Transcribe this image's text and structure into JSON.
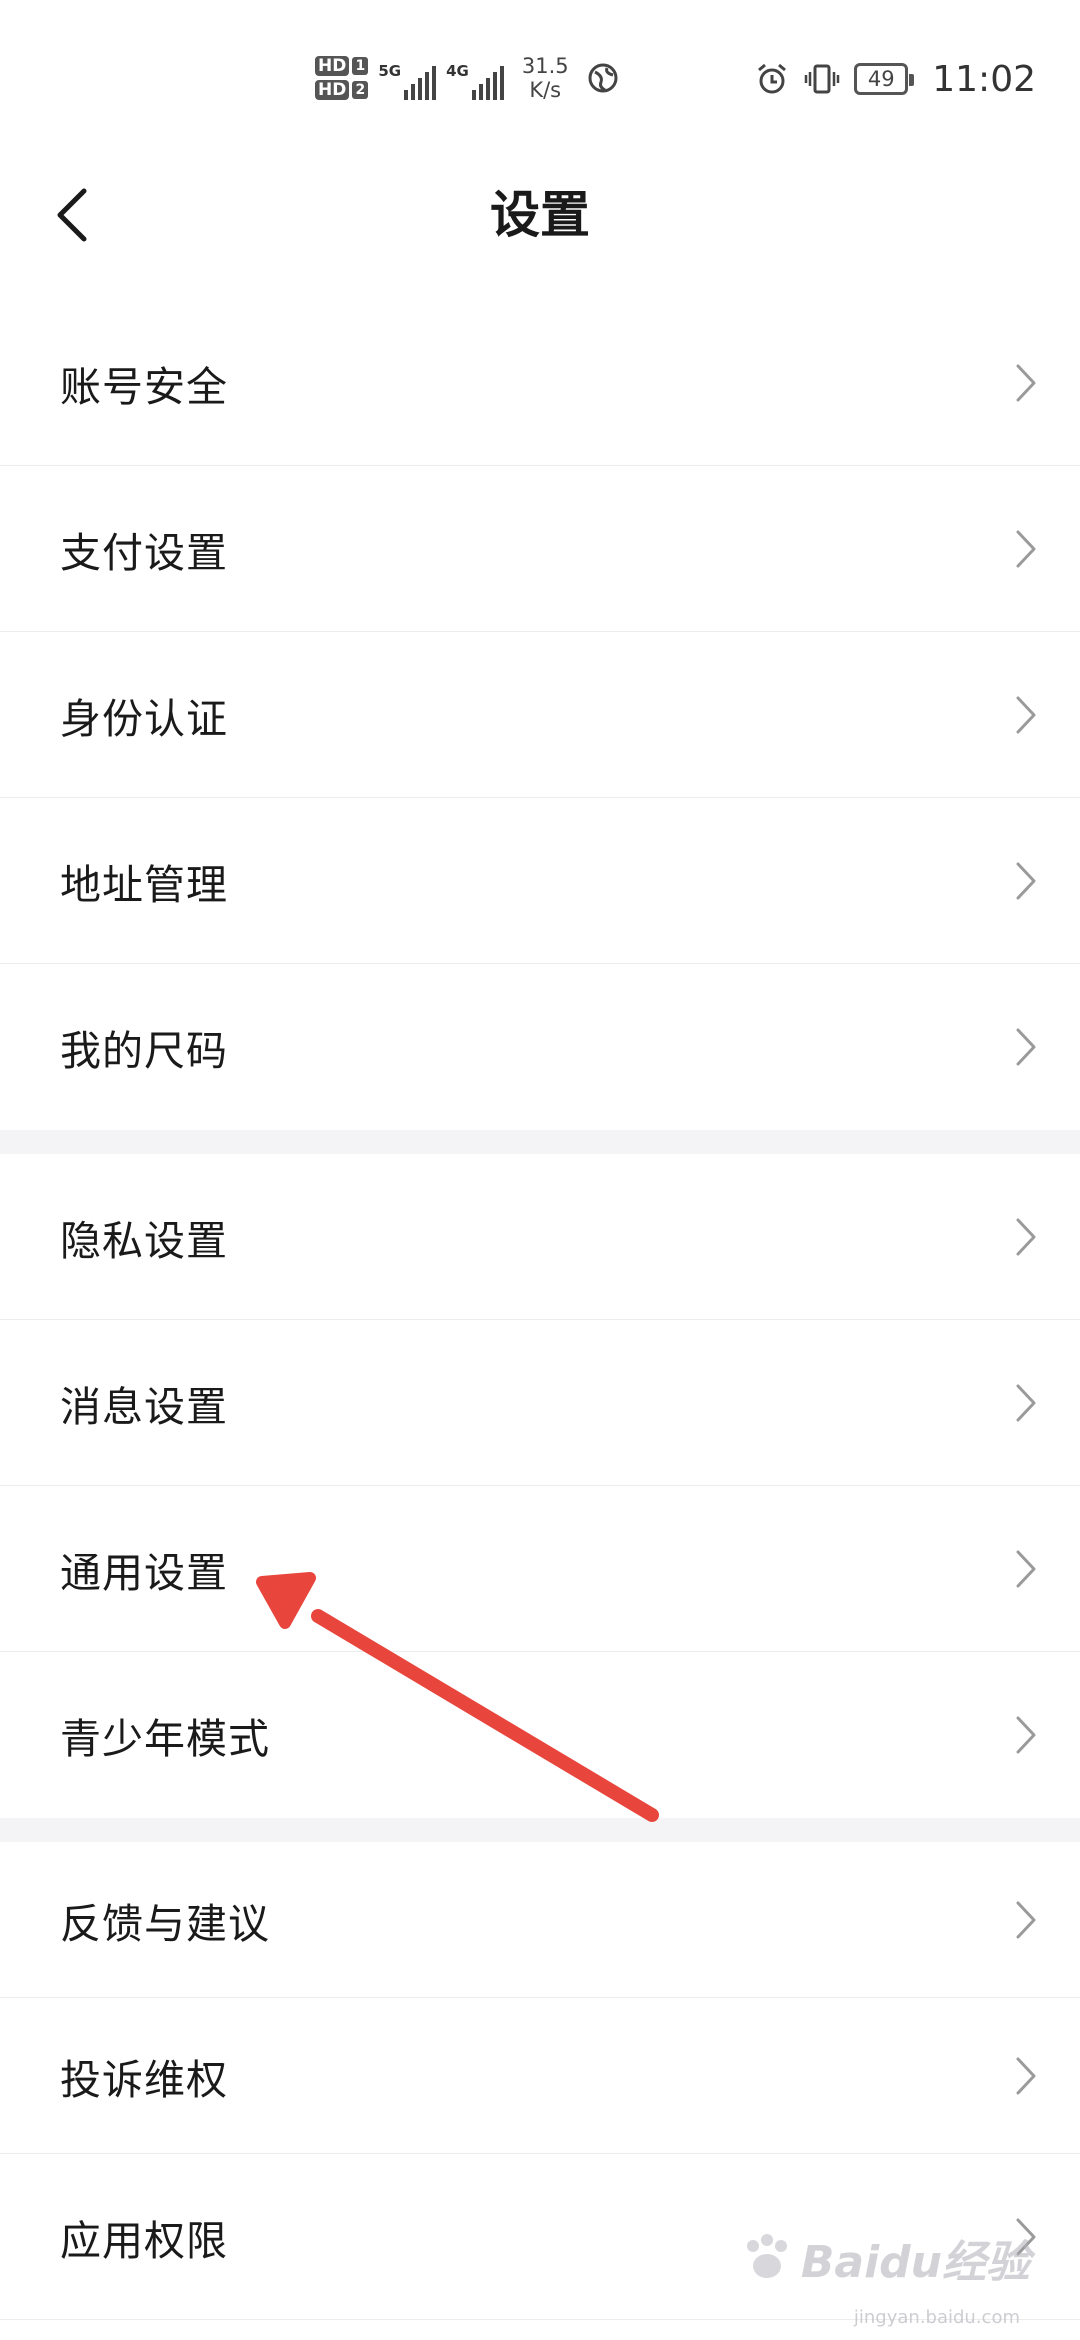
{
  "status_bar": {
    "hd1": "HD",
    "hd1_num": "1",
    "hd2": "HD",
    "hd2_num": "2",
    "net1": "5G",
    "net2": "4G",
    "speed_value": "31.5",
    "speed_unit": "K/s",
    "battery": "49",
    "time": "11:02"
  },
  "header": {
    "title": "设置"
  },
  "groups": [
    {
      "items": [
        {
          "label": "账号安全"
        },
        {
          "label": "支付设置"
        },
        {
          "label": "身份认证"
        },
        {
          "label": "地址管理"
        },
        {
          "label": "我的尺码"
        }
      ]
    },
    {
      "items": [
        {
          "label": "隐私设置"
        },
        {
          "label": "消息设置"
        },
        {
          "label": "通用设置"
        },
        {
          "label": "青少年模式"
        }
      ]
    },
    {
      "items": [
        {
          "label": "反馈与建议"
        },
        {
          "label": "投诉维权"
        },
        {
          "label": "应用权限"
        }
      ]
    }
  ],
  "annotation": {
    "color": "#e8453c",
    "target": "通用设置"
  },
  "watermark": {
    "text": "Baidu经验",
    "sub": "jingyan.baidu.com"
  }
}
